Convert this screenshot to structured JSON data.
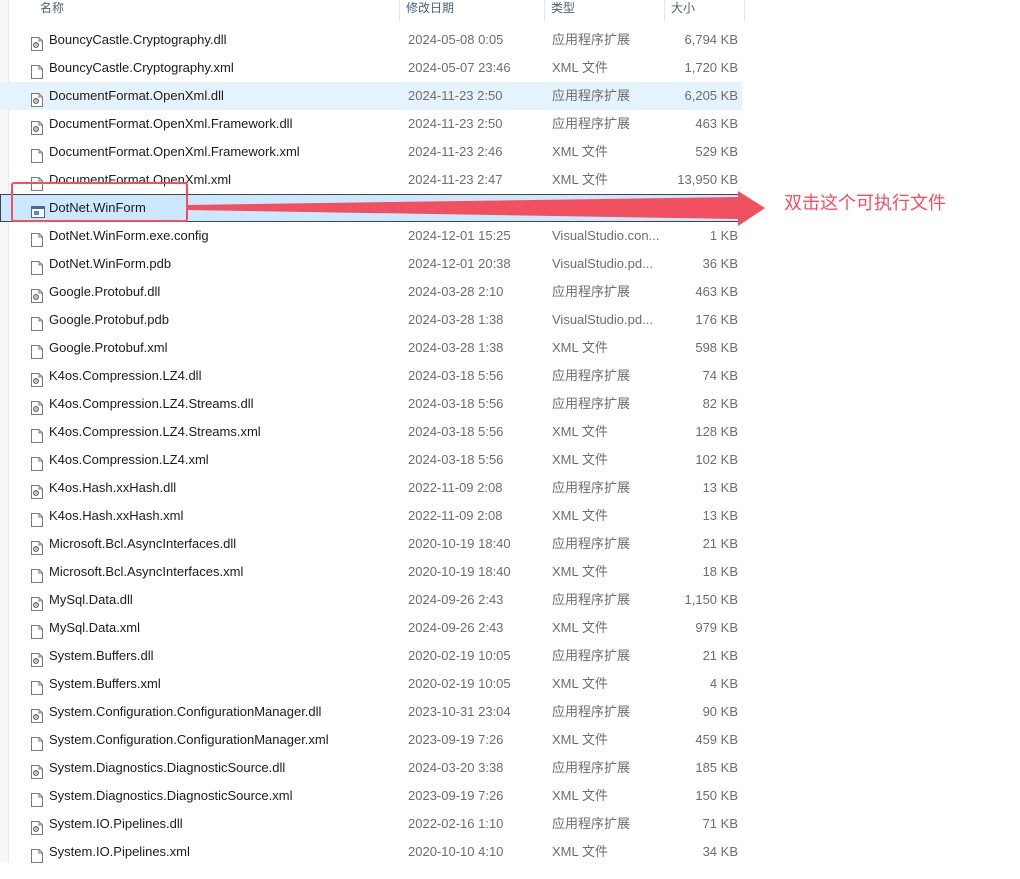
{
  "columns": {
    "name": "名称",
    "date": "修改日期",
    "type": "类型",
    "size": "大小"
  },
  "files": [
    {
      "name": "BouncyCastle.Cryptography.dll",
      "date": "2024-05-08 0:05",
      "type": "应用程序扩展",
      "size": "6,794 KB",
      "icon": "dll-gear-icon"
    },
    {
      "name": "BouncyCastle.Cryptography.xml",
      "date": "2024-05-07 23:46",
      "type": "XML 文件",
      "size": "1,720 KB",
      "icon": "document-icon"
    },
    {
      "name": "DocumentFormat.OpenXml.dll",
      "date": "2024-11-23 2:50",
      "type": "应用程序扩展",
      "size": "6,205 KB",
      "icon": "dll-gear-icon",
      "state": "hover"
    },
    {
      "name": "DocumentFormat.OpenXml.Framework.dll",
      "date": "2024-11-23 2:50",
      "type": "应用程序扩展",
      "size": "463 KB",
      "icon": "dll-gear-icon"
    },
    {
      "name": "DocumentFormat.OpenXml.Framework.xml",
      "date": "2024-11-23 2:46",
      "type": "XML 文件",
      "size": "529 KB",
      "icon": "document-icon"
    },
    {
      "name": "DocumentFormat.OpenXml.xml",
      "date": "2024-11-23 2:47",
      "type": "XML 文件",
      "size": "13,950 KB",
      "icon": "document-icon"
    },
    {
      "name": "DotNet.WinForm",
      "date": "",
      "type": "",
      "size": "",
      "icon": "executable-icon",
      "state": "selected"
    },
    {
      "name": "DotNet.WinForm.exe.config",
      "date": "2024-12-01 15:25",
      "type": "VisualStudio.con...",
      "size": "1 KB",
      "icon": "document-icon"
    },
    {
      "name": "DotNet.WinForm.pdb",
      "date": "2024-12-01 20:38",
      "type": "VisualStudio.pd...",
      "size": "36 KB",
      "icon": "document-icon"
    },
    {
      "name": "Google.Protobuf.dll",
      "date": "2024-03-28 2:10",
      "type": "应用程序扩展",
      "size": "463 KB",
      "icon": "dll-gear-icon"
    },
    {
      "name": "Google.Protobuf.pdb",
      "date": "2024-03-28 1:38",
      "type": "VisualStudio.pd...",
      "size": "176 KB",
      "icon": "document-icon"
    },
    {
      "name": "Google.Protobuf.xml",
      "date": "2024-03-28 1:38",
      "type": "XML 文件",
      "size": "598 KB",
      "icon": "document-icon"
    },
    {
      "name": "K4os.Compression.LZ4.dll",
      "date": "2024-03-18 5:56",
      "type": "应用程序扩展",
      "size": "74 KB",
      "icon": "dll-gear-icon"
    },
    {
      "name": "K4os.Compression.LZ4.Streams.dll",
      "date": "2024-03-18 5:56",
      "type": "应用程序扩展",
      "size": "82 KB",
      "icon": "dll-gear-icon"
    },
    {
      "name": "K4os.Compression.LZ4.Streams.xml",
      "date": "2024-03-18 5:56",
      "type": "XML 文件",
      "size": "128 KB",
      "icon": "document-icon"
    },
    {
      "name": "K4os.Compression.LZ4.xml",
      "date": "2024-03-18 5:56",
      "type": "XML 文件",
      "size": "102 KB",
      "icon": "document-icon"
    },
    {
      "name": "K4os.Hash.xxHash.dll",
      "date": "2022-11-09 2:08",
      "type": "应用程序扩展",
      "size": "13 KB",
      "icon": "dll-gear-icon"
    },
    {
      "name": "K4os.Hash.xxHash.xml",
      "date": "2022-11-09 2:08",
      "type": "XML 文件",
      "size": "13 KB",
      "icon": "document-icon"
    },
    {
      "name": "Microsoft.Bcl.AsyncInterfaces.dll",
      "date": "2020-10-19 18:40",
      "type": "应用程序扩展",
      "size": "21 KB",
      "icon": "dll-gear-icon"
    },
    {
      "name": "Microsoft.Bcl.AsyncInterfaces.xml",
      "date": "2020-10-19 18:40",
      "type": "XML 文件",
      "size": "18 KB",
      "icon": "document-icon"
    },
    {
      "name": "MySql.Data.dll",
      "date": "2024-09-26 2:43",
      "type": "应用程序扩展",
      "size": "1,150 KB",
      "icon": "dll-gear-icon"
    },
    {
      "name": "MySql.Data.xml",
      "date": "2024-09-26 2:43",
      "type": "XML 文件",
      "size": "979 KB",
      "icon": "document-icon"
    },
    {
      "name": "System.Buffers.dll",
      "date": "2020-02-19 10:05",
      "type": "应用程序扩展",
      "size": "21 KB",
      "icon": "dll-gear-icon"
    },
    {
      "name": "System.Buffers.xml",
      "date": "2020-02-19 10:05",
      "type": "XML 文件",
      "size": "4 KB",
      "icon": "document-icon"
    },
    {
      "name": "System.Configuration.ConfigurationManager.dll",
      "date": "2023-10-31 23:04",
      "type": "应用程序扩展",
      "size": "90 KB",
      "icon": "dll-gear-icon"
    },
    {
      "name": "System.Configuration.ConfigurationManager.xml",
      "date": "2023-09-19 7:26",
      "type": "XML 文件",
      "size": "459 KB",
      "icon": "document-icon"
    },
    {
      "name": "System.Diagnostics.DiagnosticSource.dll",
      "date": "2024-03-20 3:38",
      "type": "应用程序扩展",
      "size": "185 KB",
      "icon": "dll-gear-icon"
    },
    {
      "name": "System.Diagnostics.DiagnosticSource.xml",
      "date": "2023-09-19 7:26",
      "type": "XML 文件",
      "size": "150 KB",
      "icon": "document-icon"
    },
    {
      "name": "System.IO.Pipelines.dll",
      "date": "2022-02-16 1:10",
      "type": "应用程序扩展",
      "size": "71 KB",
      "icon": "dll-gear-icon"
    },
    {
      "name": "System.IO.Pipelines.xml",
      "date": "2020-10-10 4:10",
      "type": "XML 文件",
      "size": "34 KB",
      "icon": "document-icon"
    }
  ],
  "annotation": {
    "text": "双击这个可执行文件",
    "color": "#f0505f"
  },
  "colors": {
    "hover": "#e5f3ff",
    "selected": "#cce8ff",
    "header_text": "#4c607a"
  }
}
